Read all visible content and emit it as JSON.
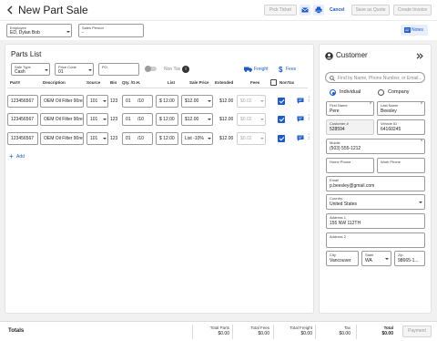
{
  "header": {
    "title": "New Part Sale",
    "pick_ticket_label": "Pick Ticket",
    "cancel_label": "Cancel",
    "save_quote_label": "Save as Quote",
    "create_invoice_label": "Create Invoice"
  },
  "employee_strip": {
    "employee_label": "Employee",
    "employee_value": "ED, Dylan Bob",
    "sales_person_label": "Sales Person",
    "sales_person_value": "-",
    "notes_label": "Notes"
  },
  "parts_list": {
    "title": "Parts List",
    "sale_type_label": "Sale Type",
    "sale_type_value": "Cash",
    "price_code_label": "Price Code",
    "price_code_value": "01",
    "po_label": "PO",
    "po_value": "",
    "non_tax_label": "Non Tax",
    "info_glyph": "i",
    "freight_label": "Freight",
    "fees_label": "Fees",
    "columns": [
      "Part#",
      "Description",
      "Source",
      "Bin",
      "Qty. /O.H.",
      "List",
      "Sale Price",
      "Extended",
      "Fees",
      "NonTax"
    ],
    "rows": [
      {
        "part": "123456567",
        "description": "OEM Oil Filter 90re...",
        "source": "101",
        "bin": "123",
        "qty": "01",
        "oh": "/10",
        "list": "$ 12.00",
        "sale_price": "$12.00",
        "extended": "$12.00",
        "fees": "$0.02"
      },
      {
        "part": "123456567",
        "description": "OEM Oil Filter 90re...",
        "source": "101",
        "bin": "123",
        "qty": "01",
        "oh": "/10",
        "list": "$ 12.00",
        "sale_price": "$12.00",
        "extended": "$12.00",
        "fees": "$0.02"
      },
      {
        "part": "123456567",
        "description": "OEM Oil Filter 90re...",
        "source": "101",
        "bin": "123",
        "qty": "01",
        "oh": "/10",
        "list": "$ 12.00",
        "sale_price": "List -10%",
        "extended": "$12.00",
        "fees": "$0.02"
      }
    ],
    "add_label": "Add"
  },
  "customer": {
    "title": "Customer",
    "search_placeholder": "Find by Name, Phone Number, or Email...",
    "individual_label": "Individual",
    "company_label": "Company",
    "required_mark": "*",
    "first_name_label": "First Name",
    "first_name_value": "Pere",
    "last_name_label": "Last Name",
    "last_name_value": "Beesley",
    "customer_no_label": "Customer #",
    "customer_no_value": "528594",
    "vehicle_id_label": "Vehicle ID",
    "vehicle_id_value": "64160245",
    "mobile_label": "Mobile",
    "mobile_value": "(503) 555-1212",
    "home_phone_label": "Home Phone",
    "work_phone_label": "Work Phone",
    "email_label": "Email",
    "email_value": "p.beesley@gmail.com",
    "country_label": "Country",
    "country_value": "United States",
    "address1_label": "Address 1",
    "address1_value": "155 NW 112TH",
    "address2_label": "Address 2",
    "city_label": "City",
    "city_value": "Vancouver",
    "state_label": "State",
    "state_value": "WA",
    "zip_label": "Zip",
    "zip_value": "98665-1..."
  },
  "totals": {
    "label": "Totals",
    "parts_label": "Total Parts",
    "parts_value": "$0.00",
    "fees_label": "Total Fees",
    "fees_value": "$0.00",
    "freight_label": "Total Freight",
    "freight_value": "$0.00",
    "tax_label": "Tax",
    "tax_value": "$0.00",
    "total_label": "Total",
    "total_value": "$0.00",
    "payment_label": "Payment"
  },
  "colors": {
    "accent": "#1e5bc6",
    "background": "#f1f1f2",
    "disabled_text": "#9a9a9a"
  }
}
